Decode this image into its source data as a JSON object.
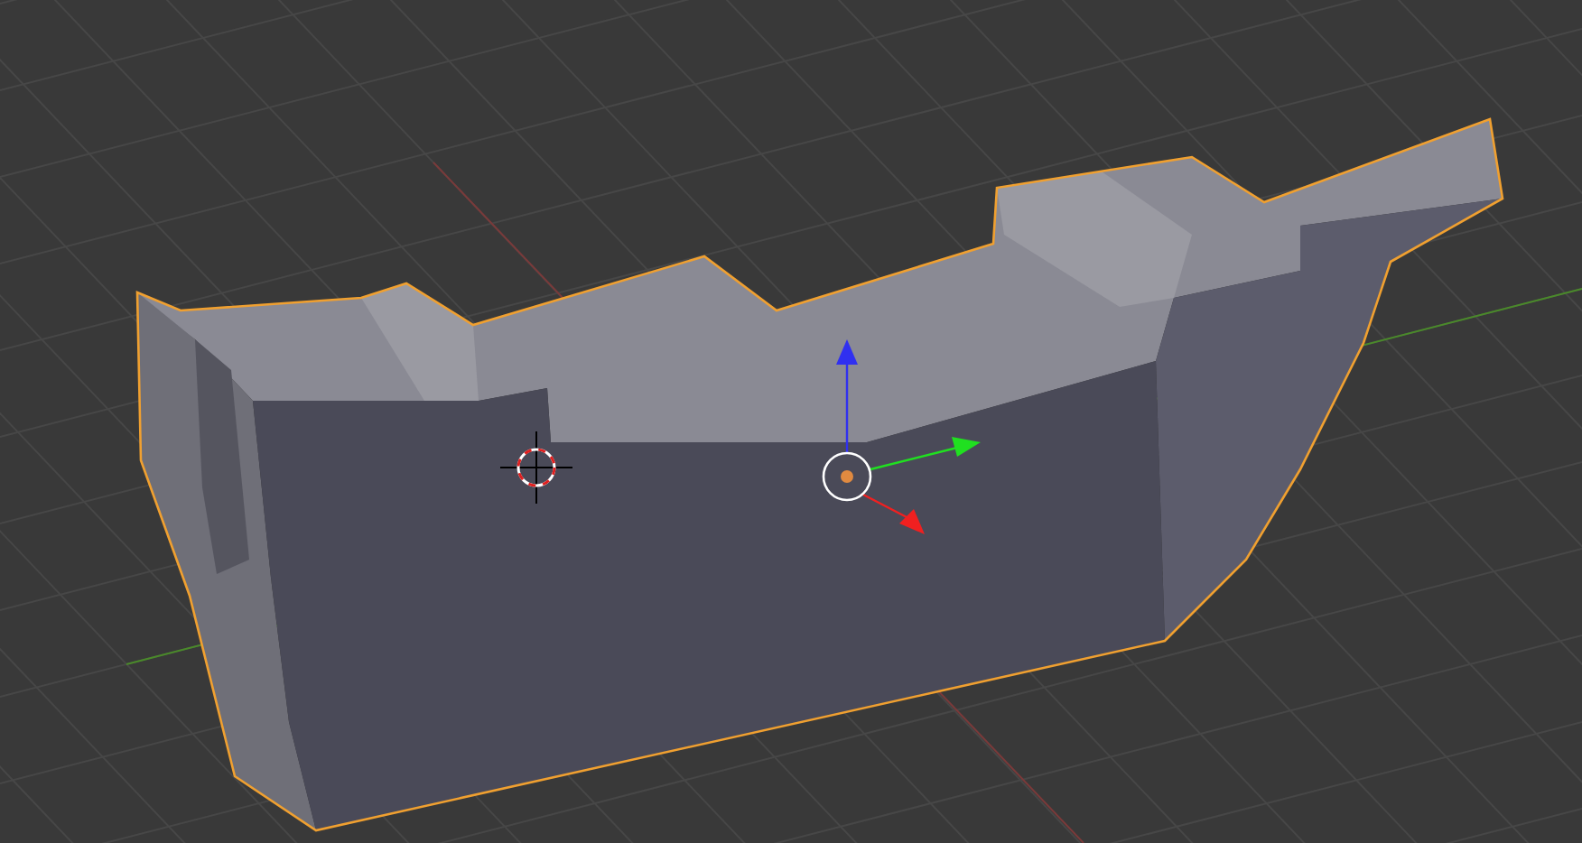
{
  "viewport": {
    "object_selected": true
  }
}
